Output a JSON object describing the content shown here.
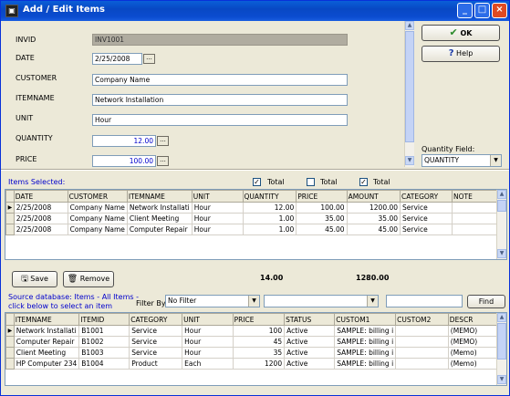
{
  "window": {
    "title": "Add / Edit Items"
  },
  "form": {
    "invid_label": "INVID",
    "invid_value": "INV1001",
    "date_label": "DATE",
    "date_value": "2/25/2008",
    "customer_label": "CUSTOMER",
    "customer_value": "Company Name",
    "itemname_label": "ITEMNAME",
    "itemname_value": "Network Installation",
    "unit_label": "UNIT",
    "unit_value": "Hour",
    "quantity_label": "QUANTITY",
    "quantity_value": "12.00",
    "price_label": "PRICE",
    "price_value": "100.00",
    "dots": "..."
  },
  "side": {
    "ok_label": "OK",
    "help_label": "Help",
    "quantity_field_label": "Quantity Field:",
    "quantity_field_value": "QUANTITY"
  },
  "selected": {
    "label": "Items Selected:",
    "total_label": "Total",
    "total_checks": [
      true,
      false,
      true
    ],
    "columns": [
      "DATE",
      "CUSTOMER",
      "ITEMNAME",
      "UNIT",
      "QUANTITY",
      "PRICE",
      "AMOUNT",
      "CATEGORY",
      "NOTE"
    ],
    "rows": [
      [
        "2/25/2008",
        "Company Name",
        "Network Installati",
        "Hour",
        "12.00",
        "100.00",
        "1200.00",
        "Service",
        ""
      ],
      [
        "2/25/2008",
        "Company Name",
        "Client Meeting",
        "Hour",
        "1.00",
        "35.00",
        "35.00",
        "Service",
        ""
      ],
      [
        "2/25/2008",
        "Company Name",
        "Computer Repair",
        "Hour",
        "1.00",
        "45.00",
        "45.00",
        "Service",
        ""
      ]
    ],
    "save_label": "Save",
    "remove_label": "Remove",
    "total_quantity": "14.00",
    "total_amount": "1280.00"
  },
  "source": {
    "label_line1": "Source database: Items - All Items -",
    "label_line2": "click below to select an item",
    "filter_label": "Filter By:",
    "filter_value": "No Filter",
    "second_value": "",
    "find_label": "Find",
    "columns": [
      "ITEMNAME",
      "ITEMID",
      "CATEGORY",
      "UNIT",
      "PRICE",
      "STATUS",
      "CUSTOM1",
      "CUSTOM2",
      "DESCR"
    ],
    "rows": [
      [
        "Network Installati",
        "B1001",
        "Service",
        "Hour",
        "100",
        "Active",
        "SAMPLE: billing i",
        "",
        "(MEMO)"
      ],
      [
        "Computer Repair",
        "B1002",
        "Service",
        "Hour",
        "45",
        "Active",
        "SAMPLE: billing i",
        "",
        "(MEMO)"
      ],
      [
        "Client Meeting",
        "B1003",
        "Service",
        "Hour",
        "35",
        "Active",
        "SAMPLE: billing i",
        "",
        "(Memo)"
      ],
      [
        "HP Computer 234",
        "B1004",
        "Product",
        "Each",
        "1200",
        "Active",
        "SAMPLE: billing i",
        "",
        "(Memo)"
      ]
    ]
  }
}
